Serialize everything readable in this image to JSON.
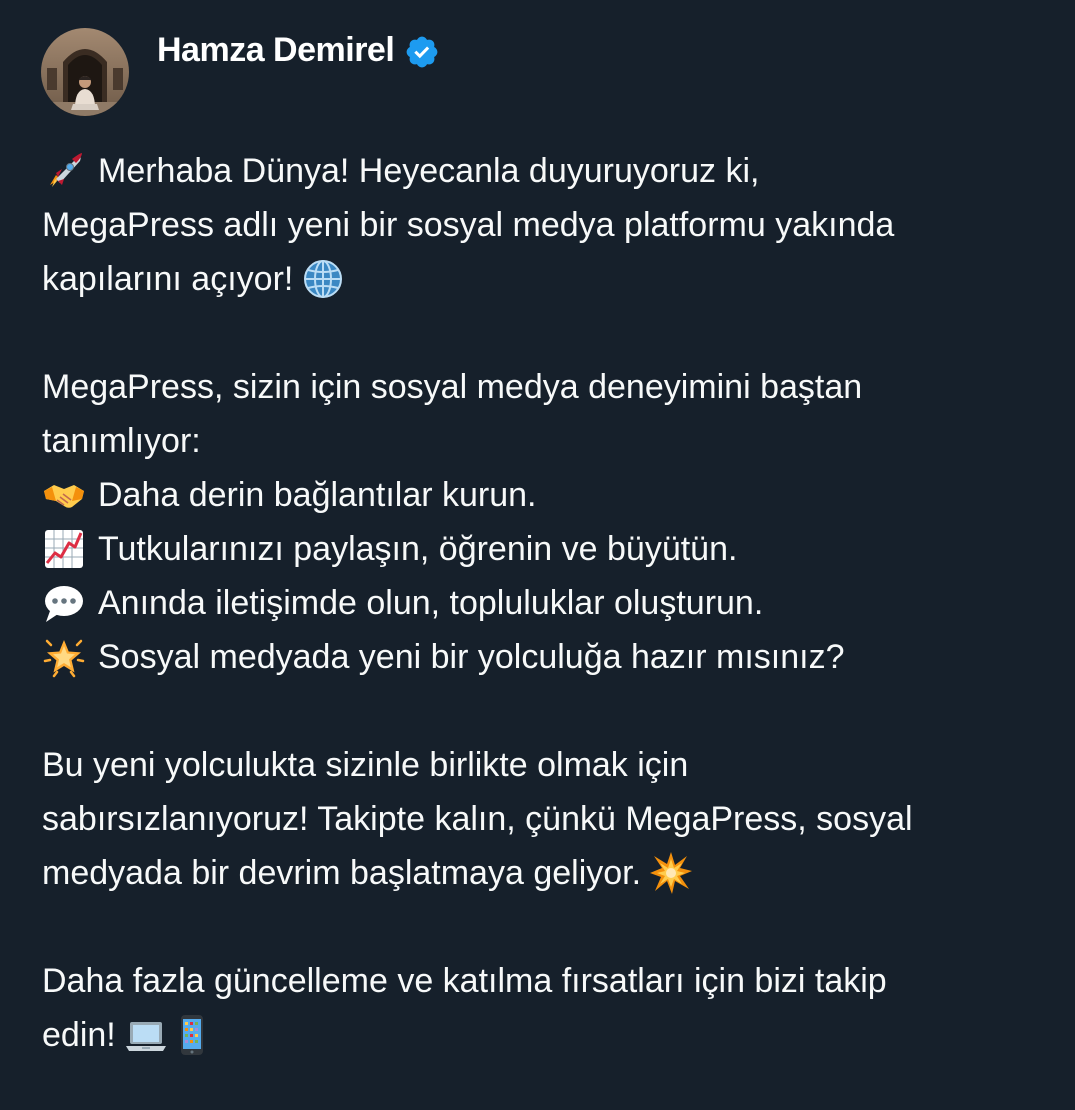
{
  "post": {
    "author": {
      "name": "Hamza Demirel",
      "verified": true
    },
    "intro": {
      "line1": "Merhaba Dünya! Heyecanla duyuruyoruz ki,",
      "line2": "MegaPress adlı yeni bir sosyal medya platformu yakında",
      "line3": "kapılarını açıyor!"
    },
    "features_intro": {
      "line1": "MegaPress, sizin için sosyal medya deneyimini baştan",
      "line2": "tanımlıyor:"
    },
    "features": [
      {
        "icon": "handshake-icon",
        "text": "Daha derin bağlantılar kurun."
      },
      {
        "icon": "chart-increasing-icon",
        "text": "Tutkularınızı paylaşın, öğrenin ve büyütün."
      },
      {
        "icon": "speech-bubble-icon",
        "text": "Anında iletişimde olun, topluluklar oluşturun."
      },
      {
        "icon": "glowing-star-icon",
        "text": "Sosyal medyada yeni bir yolculuğa hazır mısınız?"
      }
    ],
    "closing": {
      "line1": "Bu yeni yolculukta sizinle birlikte olmak için",
      "line2": "sabırsızlanıyoruz! Takipte kalın, çünkü MegaPress, sosyal",
      "line3": "medyada bir devrim başlatmaya geliyor."
    },
    "cta": {
      "line1": "Daha fazla güncelleme ve katılma fırsatları için bizi takip",
      "line2": "edin!"
    }
  },
  "colors": {
    "background": "#16202b",
    "text": "#f7f9f9",
    "verified": "#1d9bf0"
  }
}
